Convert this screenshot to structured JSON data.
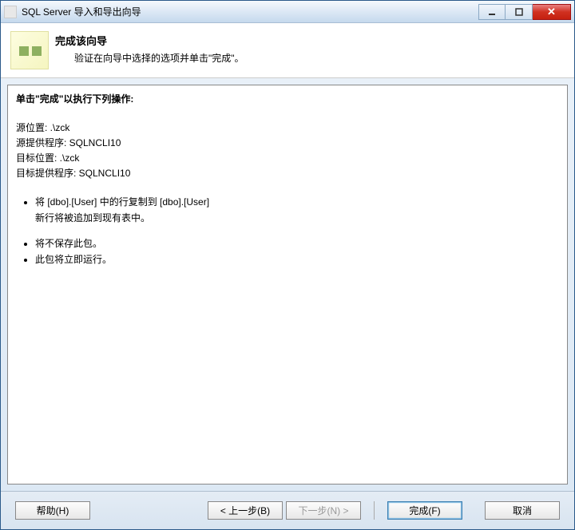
{
  "titlebar": {
    "title": "SQL Server 导入和导出向导"
  },
  "header": {
    "title": "完成该向导",
    "subtitle": "验证在向导中选择的选项并单击\"完成\"。"
  },
  "content": {
    "instruction": "单击\"完成\"以执行下列操作:",
    "source_location_label": "源位置: ",
    "source_location_value": ".\\zck",
    "source_provider_label": "源提供程序: ",
    "source_provider_value": "SQLNCLI10",
    "target_location_label": "目标位置: ",
    "target_location_value": ".\\zck",
    "target_provider_label": "目标提供程序: ",
    "target_provider_value": "SQLNCLI10",
    "bullets1": [
      "将 [dbo].[User] 中的行复制到 [dbo].[User]",
      "新行将被追加到现有表中。"
    ],
    "bullets2": [
      "将不保存此包。",
      "此包将立即运行。"
    ]
  },
  "buttons": {
    "help": "帮助(H)",
    "back": "< 上一步(B)",
    "next": "下一步(N) >",
    "finish": "完成(F)",
    "cancel": "取消"
  }
}
